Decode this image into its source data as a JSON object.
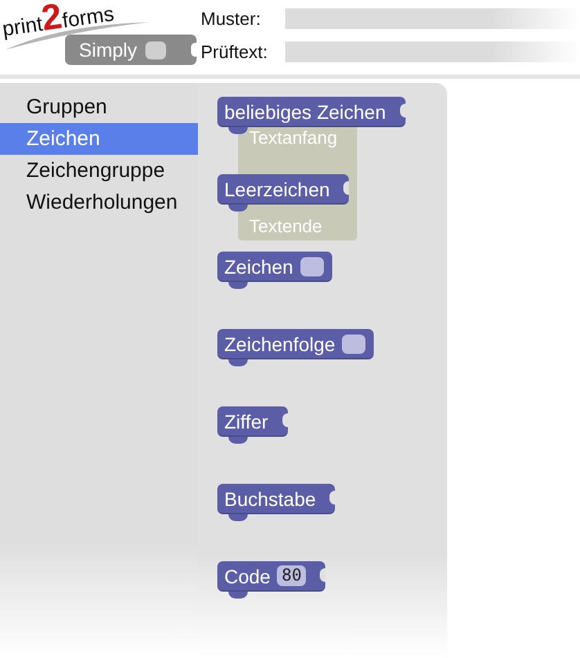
{
  "logo": {
    "text_left": "print",
    "digit": "2",
    "text_right": "forms",
    "badge": "Simply"
  },
  "fields": [
    {
      "label": "Muster:"
    },
    {
      "label": "Prüftext:"
    }
  ],
  "toolbox": {
    "items": [
      {
        "label": "Gruppen",
        "selected": false
      },
      {
        "label": "Zeichen",
        "selected": true
      },
      {
        "label": "Zeichengruppe",
        "selected": false
      },
      {
        "label": "Wiederholungen",
        "selected": false
      }
    ]
  },
  "workspace_blocks": [
    {
      "text": "Textanfang"
    },
    {
      "text": "Textende"
    }
  ],
  "flyout": {
    "blocks": [
      {
        "kind": "plain",
        "label": "beliebiges Zeichen"
      },
      {
        "kind": "plain",
        "label": "Leerzeichen"
      },
      {
        "kind": "input",
        "label": "Zeichen"
      },
      {
        "kind": "input",
        "label": "Zeichenfolge"
      },
      {
        "kind": "plain",
        "label": "Ziffer"
      },
      {
        "kind": "plain",
        "label": "Buchstabe"
      },
      {
        "kind": "number",
        "label": "Code",
        "value": "80"
      }
    ]
  }
}
